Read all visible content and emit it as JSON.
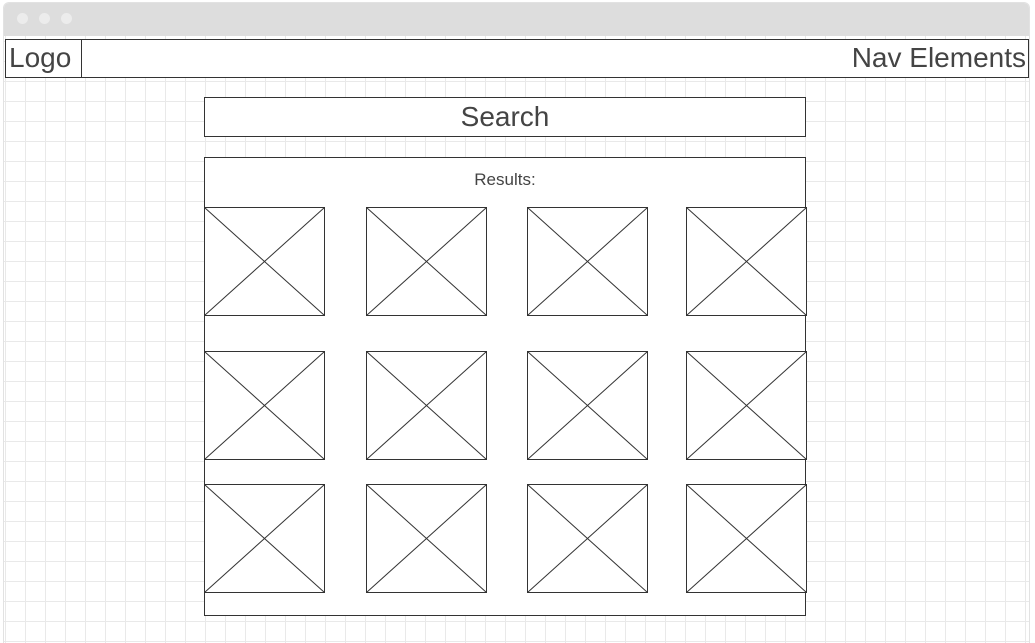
{
  "header": {
    "logo": "Logo",
    "nav": "Nav Elements"
  },
  "search": {
    "label": "Search"
  },
  "results": {
    "label": "Results:",
    "items": [
      {
        "icon": "image-placeholder-icon"
      },
      {
        "icon": "image-placeholder-icon"
      },
      {
        "icon": "image-placeholder-icon"
      },
      {
        "icon": "image-placeholder-icon"
      },
      {
        "icon": "image-placeholder-icon"
      },
      {
        "icon": "image-placeholder-icon"
      },
      {
        "icon": "image-placeholder-icon"
      },
      {
        "icon": "image-placeholder-icon"
      },
      {
        "icon": "image-placeholder-icon"
      },
      {
        "icon": "image-placeholder-icon"
      },
      {
        "icon": "image-placeholder-icon"
      },
      {
        "icon": "image-placeholder-icon"
      }
    ]
  },
  "colors": {
    "titlebar": "#dddddd",
    "border": "#333333",
    "text": "#444444",
    "grid": "#e9e9e9"
  }
}
